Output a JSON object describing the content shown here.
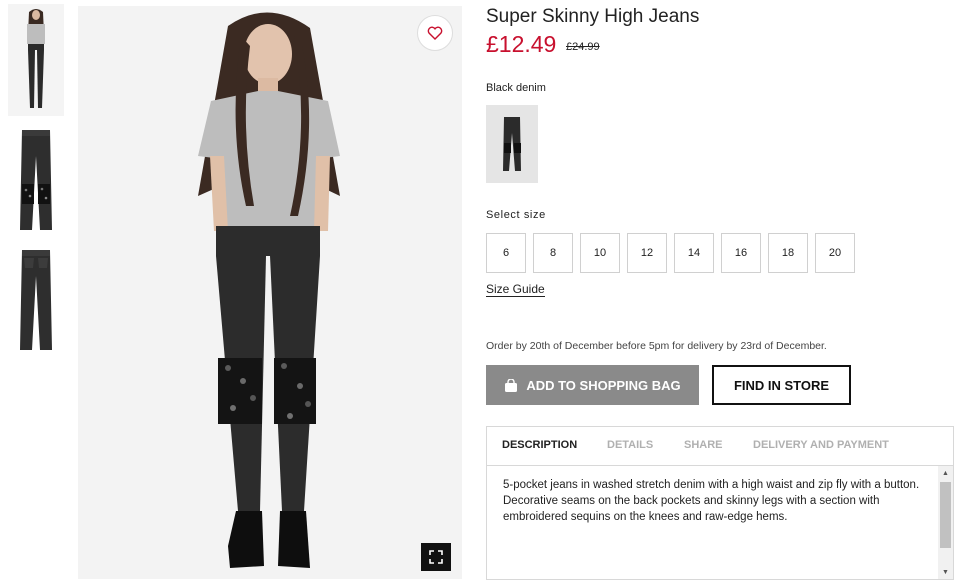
{
  "product": {
    "title": "Super Skinny High Jeans",
    "price": "£12.49",
    "old_price": "£24.99",
    "color_label": "Black denim"
  },
  "sizes": {
    "label": "Select size",
    "options": [
      "6",
      "8",
      "10",
      "12",
      "14",
      "16",
      "18",
      "20"
    ],
    "guide_label": "Size Guide"
  },
  "delivery_note": "Order by 20th of December before 5pm for delivery by 23rd of December.",
  "actions": {
    "add_to_bag": "ADD TO SHOPPING BAG",
    "find_in_store": "FIND IN STORE"
  },
  "tabs": [
    "DESCRIPTION",
    "DETAILS",
    "SHARE",
    "DELIVERY AND PAYMENT"
  ],
  "active_tab": "DESCRIPTION",
  "description": "5-pocket jeans in washed stretch denim with a high waist and zip fly with a button. Decorative seams on the back pockets and skinny legs with a section with embroidered sequins on the knees and raw-edge hems.",
  "colors": {
    "price_red": "#c8102e",
    "add_button": "#8a8a8a",
    "zoom_button": "#111111"
  },
  "icons": [
    "heart-icon",
    "expand-icon",
    "shopping-bag-icon",
    "scroll-up-arrow",
    "scroll-down-arrow"
  ]
}
